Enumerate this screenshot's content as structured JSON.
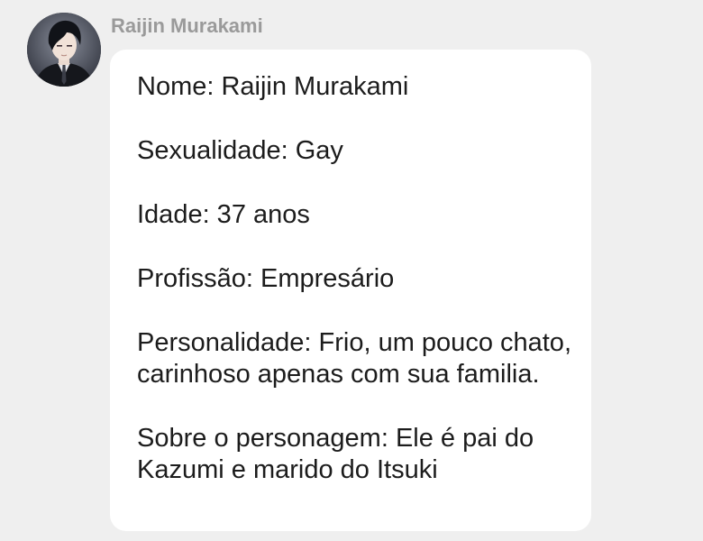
{
  "author": {
    "name": "Raijin Murakami"
  },
  "profile": {
    "nome": "Nome: Raijin Murakami",
    "sexualidade": "Sexualidade: Gay",
    "idade": "Idade: 37 anos",
    "profissao": "Profissão: Empresário",
    "personalidade": "Personalidade: Frio, um pouco chato, carinhoso apenas com sua familia.",
    "sobre": "Sobre o personagem: Ele é pai do Kazumi e marido do Itsuki"
  }
}
